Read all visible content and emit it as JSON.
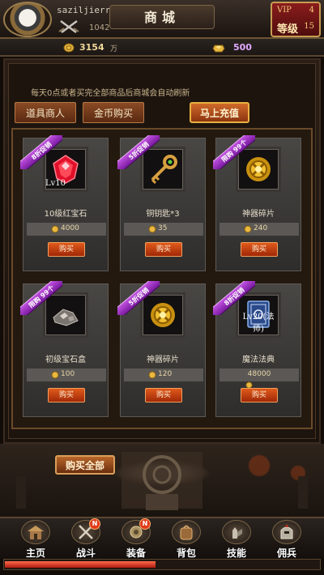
{
  "player": {
    "name": "saziljierr",
    "power": "1042"
  },
  "header": {
    "title": "商城"
  },
  "vip": {
    "label": "VIP",
    "vip_level": "4",
    "level_label": "等级",
    "level_value": "15"
  },
  "currency": {
    "coins": "3154",
    "coins_unit": "万",
    "ingots": "500"
  },
  "shop": {
    "notice": "每天0点或者买完全部商品后商城会自动刷新",
    "tabs": [
      "道具商人",
      "金币购买"
    ],
    "recharge_label": "马上充值",
    "buy_label": "购买",
    "buy_all_label": "购买全部",
    "items": [
      {
        "name": "10级红宝石",
        "lv": "Lv10",
        "ribbon": "8折促销",
        "price": "4000",
        "icon": "red-gem-icon"
      },
      {
        "name": "铜钥匙*3",
        "lv": "",
        "ribbon": "5折促销",
        "price": "35",
        "icon": "bronze-key-icon"
      },
      {
        "name": "神器碎片",
        "lv": "",
        "ribbon": "限购 99个",
        "price": "240",
        "icon": "artifact-shard-icon"
      },
      {
        "name": "初级宝石盒",
        "lv": "",
        "ribbon": "限购 99个",
        "price": "100",
        "icon": "gem-box-icon"
      },
      {
        "name": "神器碎片",
        "lv": "",
        "ribbon": "5折促销",
        "price": "120",
        "icon": "artifact-shard-icon"
      },
      {
        "name": "魔法法典",
        "lv": "Lv20(法师)",
        "ribbon": "8折促销",
        "price": "48000",
        "icon": "spell-book-icon"
      }
    ]
  },
  "nav": {
    "items": [
      {
        "label": "主页",
        "icon": "home-icon",
        "badge": ""
      },
      {
        "label": "战斗",
        "icon": "battle-icon",
        "badge": "N"
      },
      {
        "label": "装备",
        "icon": "equipment-icon",
        "badge": "N"
      },
      {
        "label": "背包",
        "icon": "backpack-icon",
        "badge": ""
      },
      {
        "label": "技能",
        "icon": "skill-icon",
        "badge": ""
      },
      {
        "label": "佣兵",
        "icon": "mercenary-icon",
        "badge": ""
      }
    ]
  },
  "experience": {
    "progress": 0.48
  },
  "colors": {
    "accent": "#e05a1a",
    "ribbon": "#a030c0",
    "ingot": "#e0a8ff"
  }
}
